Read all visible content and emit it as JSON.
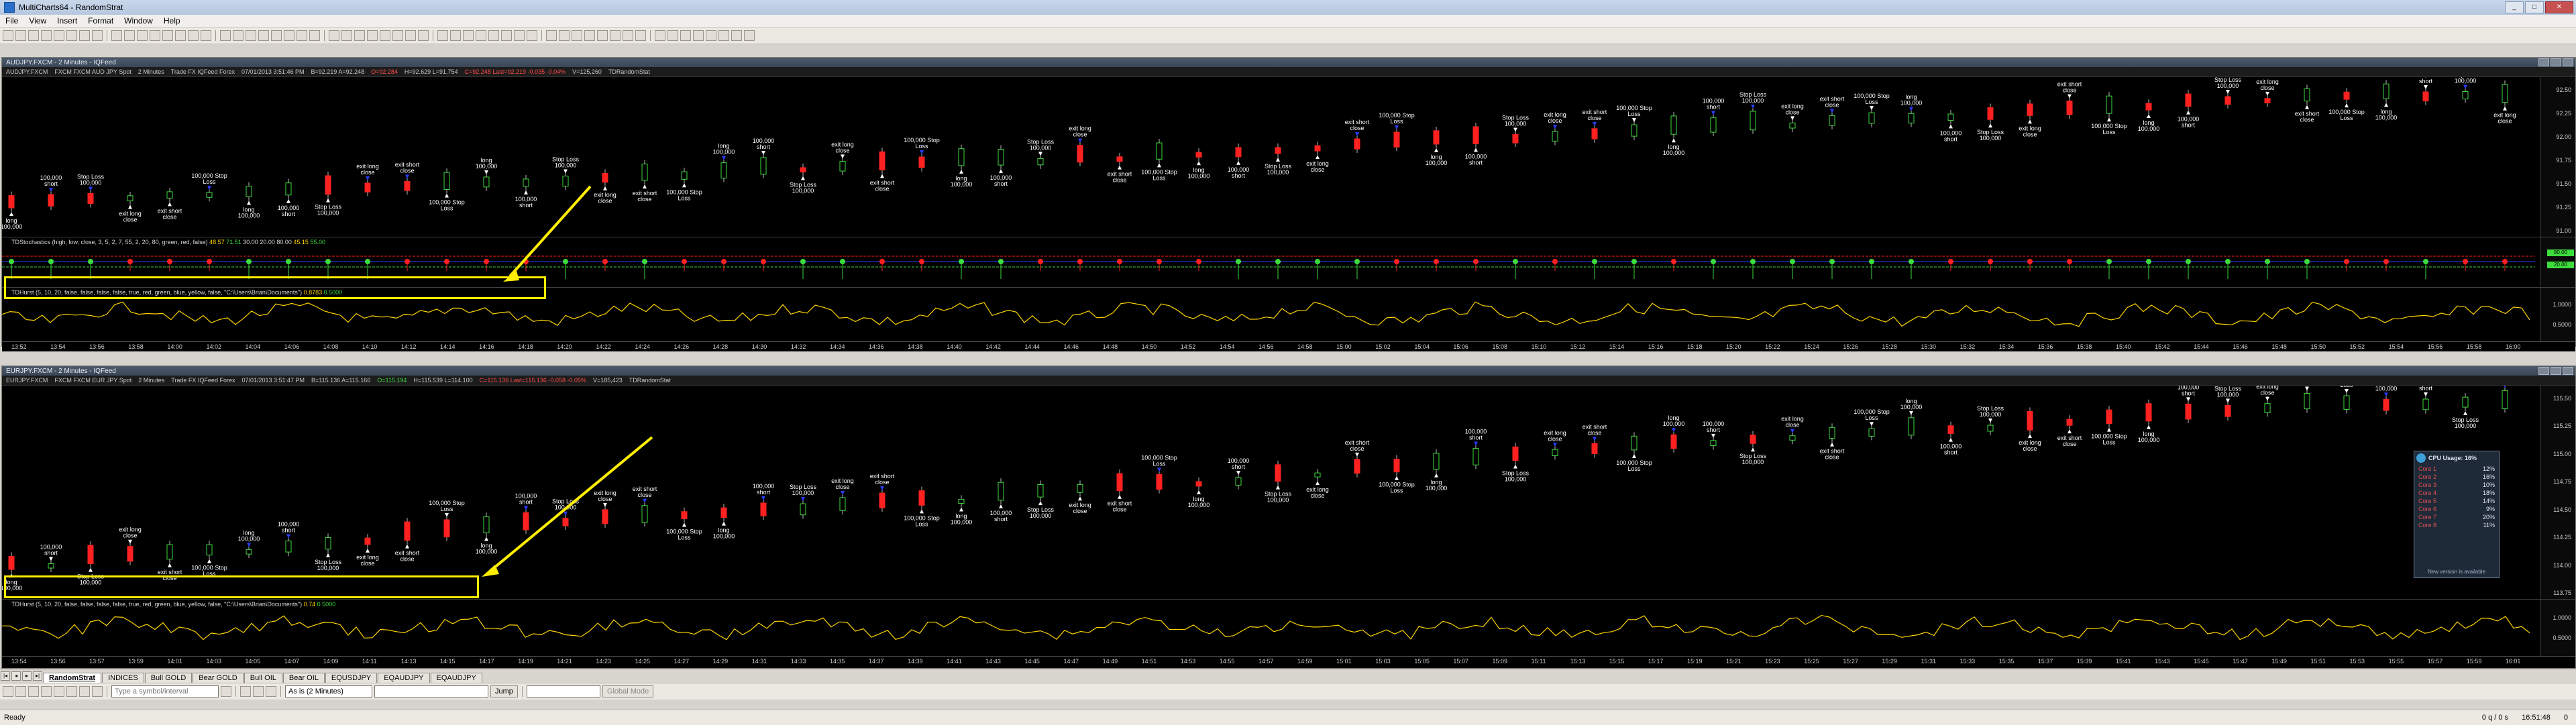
{
  "window": {
    "title": "MultiCharts64 - RandomStrat",
    "controls": [
      "_",
      "□",
      "✕"
    ]
  },
  "menu": [
    "File",
    "View",
    "Insert",
    "Format",
    "Window",
    "Help"
  ],
  "charts": [
    {
      "title": "AUDJPY.FXCM - 2 Minutes - IQFeed",
      "status": {
        "symbol": "AUDJPY.FXCM",
        "desc": "FXCM FXCM AUD JPY Spot",
        "interval": "2 Minutes",
        "type": "Trade  FX  IQFeed  Forex",
        "datetime": "07/01/2013  3:51:46 PM",
        "bar": "B=92.219  A=92.248",
        "change": "O=92.284",
        "last": "H=92.629  L=91.754",
        "chg_red": "C=92.248  Last=92.219  -0.035  -0.04%",
        "volume": "V=125,260",
        "strategy": "TDRandomStat"
      },
      "indicator1": {
        "label": "TDStochastics (high, low, close, 3, 5, 2, 7, 55, 2, 20, 80, green, red, false)",
        "values": [
          "48.57",
          "71.51",
          "30.00",
          "20.00",
          "80.00",
          "45.15",
          "55.00"
        ]
      },
      "indicator2": {
        "label": "TDHurst (5, 10, 20, false, false, false, false, true, red, green, blue, yellow, false, \"C:\\Users\\Brian\\Documents\")",
        "values": [
          "0.8783",
          "0.5000"
        ]
      },
      "prices": [
        "92.50",
        "92.25",
        "92.00",
        "91.75",
        "91.50",
        "91.25",
        "91.00"
      ],
      "current_price": "92.219",
      "stoch_scale": [
        "80.00",
        "20.00"
      ],
      "hurst_scale": [
        "1.0000",
        "0.5000"
      ],
      "times": [
        "13:52",
        "13:54",
        "13:56",
        "13:58",
        "14:00",
        "14:02",
        "14:04",
        "14:06",
        "14:08",
        "14:10",
        "14:12",
        "14:14",
        "14:16",
        "14:18",
        "14:20",
        "14:22",
        "14:24",
        "14:26",
        "14:28",
        "14:30",
        "14:32",
        "14:34",
        "14:36",
        "14:38",
        "14:40",
        "14:42",
        "14:44",
        "14:46",
        "14:48",
        "14:50",
        "14:52",
        "14:54",
        "14:56",
        "14:58",
        "15:00",
        "15:02",
        "15:04",
        "15:06",
        "15:08",
        "15:10",
        "15:12",
        "15:14",
        "15:16",
        "15:18",
        "15:20",
        "15:22",
        "15:24",
        "15:26",
        "15:28",
        "15:30",
        "15:32",
        "15:34",
        "15:36",
        "15:38",
        "15:40",
        "15:42",
        "15:44",
        "15:46",
        "15:48",
        "15:50",
        "15:52",
        "15:54",
        "15:56",
        "15:58",
        "16:00"
      ],
      "trade_labels": [
        "long 100,000",
        "100,000 short",
        "Stop Loss 100,000",
        "exit long close",
        "exit short close",
        "100,000 Stop Loss"
      ]
    },
    {
      "title": "EURJPY.FXCM - 2 Minutes - IQFeed",
      "status": {
        "symbol": "EURJPY.FXCM",
        "desc": "FXCM FXCM EUR JPY Spot",
        "interval": "2 Minutes",
        "type": "Trade  FX  IQFeed  Forex",
        "datetime": "07/01/2013  3:51:47 PM",
        "bar": "B=115.136  A=115.166",
        "change": "O=115.194",
        "last": "H=115.539  L=114.100",
        "chg_red": "C=115.136  Last=115.136  -0.058  -0.05%",
        "volume": "V=185,423",
        "strategy": "TDRandomStat"
      },
      "indicator2": {
        "label": "TDHurst (5, 10, 20, false, false, false, false, true, red, green, blue, yellow, false, \"C:\\Users\\Brian\\Documents\")",
        "values": [
          "0.74",
          "0.5000"
        ]
      },
      "prices": [
        "115.50",
        "115.25",
        "115.00",
        "114.75",
        "114.50",
        "114.25",
        "114.00",
        "113.75"
      ],
      "current_price": "115.136",
      "hurst_scale": [
        "1.0000",
        "0.5000"
      ],
      "times": [
        "13:54",
        "13:56",
        "13:57",
        "13:59",
        "14:01",
        "14:03",
        "14:05",
        "14:07",
        "14:09",
        "14:11",
        "14:13",
        "14:15",
        "14:17",
        "14:19",
        "14:21",
        "14:23",
        "14:25",
        "14:27",
        "14:29",
        "14:31",
        "14:33",
        "14:35",
        "14:37",
        "14:39",
        "14:41",
        "14:43",
        "14:45",
        "14:47",
        "14:49",
        "14:51",
        "14:53",
        "14:55",
        "14:57",
        "14:59",
        "15:01",
        "15:03",
        "15:05",
        "15:07",
        "15:09",
        "15:11",
        "15:13",
        "15:15",
        "15:17",
        "15:19",
        "15:21",
        "15:23",
        "15:25",
        "15:27",
        "15:29",
        "15:31",
        "15:33",
        "15:35",
        "15:37",
        "15:39",
        "15:41",
        "15:43",
        "15:45",
        "15:47",
        "15:49",
        "15:51",
        "15:53",
        "15:55",
        "15:57",
        "15:59",
        "16:01"
      ],
      "trade_labels": [
        "long 100,000",
        "100,000 short",
        "Stop Loss 100,000",
        "exit long close",
        "exit short close",
        "100,000 Stop Loss"
      ]
    }
  ],
  "cpu_widget": {
    "title": "CPU Usage: 16%",
    "rows": [
      {
        "name": "Core 1",
        "pct": "12%"
      },
      {
        "name": "Core 2",
        "pct": "16%"
      },
      {
        "name": "Core 3",
        "pct": "10%"
      },
      {
        "name": "Core 4",
        "pct": "18%"
      },
      {
        "name": "Core 5",
        "pct": "14%"
      },
      {
        "name": "Core 6",
        "pct": "9%"
      },
      {
        "name": "Core 7",
        "pct": "20%"
      },
      {
        "name": "Core 8",
        "pct": "11%"
      }
    ],
    "footer": "New version is available"
  },
  "tabs": [
    "RandomStrat",
    "INDICES",
    "Bull GOLD",
    "Bear GOLD",
    "Bull OIL",
    "Bear OIL",
    "EQUSDJPY",
    "EQAUDJPY",
    "EQAUDJPY"
  ],
  "bottom_toolbar": {
    "symbol_placeholder": "Type a symbol/interval",
    "interval": "As is (2 Minutes)",
    "jump": "Jump",
    "global_mode": "Global Mode"
  },
  "status_bar": {
    "left": "Ready",
    "counter": "0 q / 0 s",
    "clock": "16:51:48",
    "extra": "0"
  },
  "colors": {
    "up_candle": "#3ddc3d",
    "down_candle": "#ff2020",
    "hurst_line": "#ffd400",
    "highlight": "#ffee00",
    "blue_marker": "#2a3cff"
  }
}
